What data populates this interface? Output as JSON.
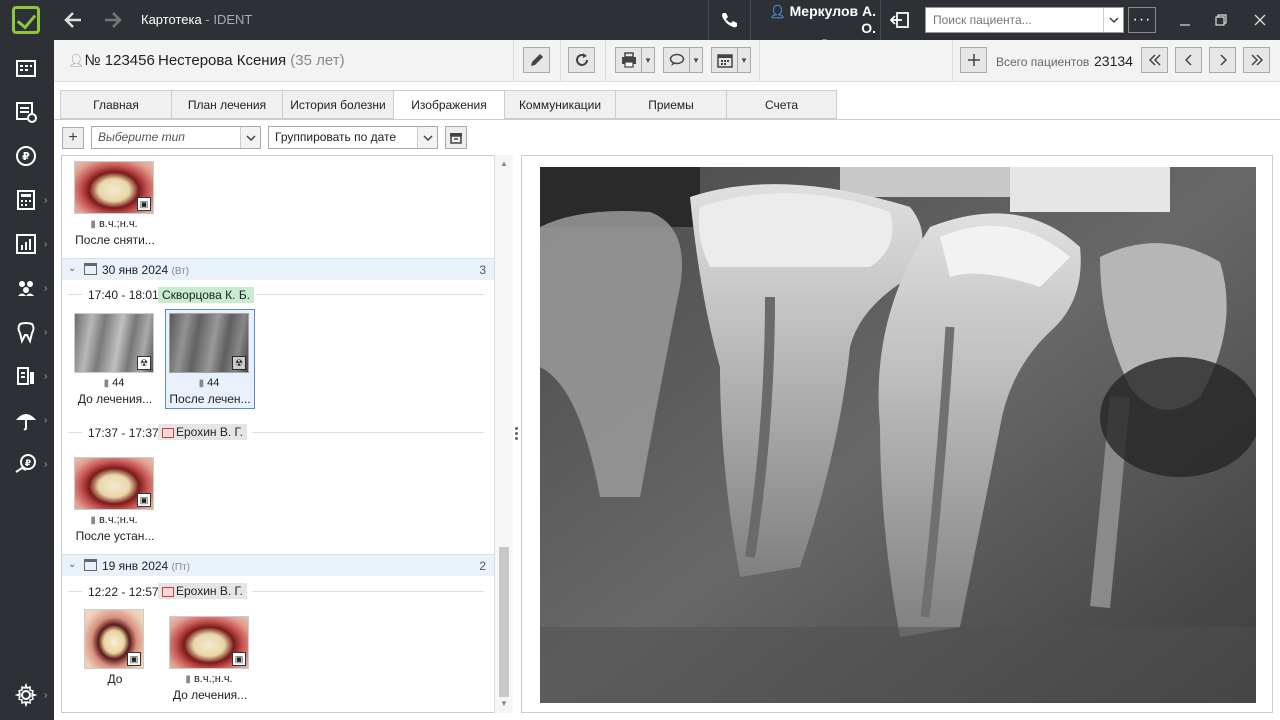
{
  "window": {
    "title": "Картотека",
    "app": "IDENT"
  },
  "user": {
    "name": "Меркулов А. О.",
    "role": "Директор"
  },
  "search": {
    "placeholder": "Поиск пациента..."
  },
  "patient": {
    "number": "№ 123456",
    "name": "Нестерова Ксения",
    "age": "(35 лет)",
    "total_label": "Всего пациентов",
    "total_value": "23134"
  },
  "tabs": [
    {
      "label": "Главная"
    },
    {
      "label": "План лечения"
    },
    {
      "label": "История болезни"
    },
    {
      "label": "Изображения",
      "active": true
    },
    {
      "label": "Коммуникации"
    },
    {
      "label": "Приемы"
    },
    {
      "label": "Счета"
    }
  ],
  "filters": {
    "type_placeholder": "Выберите тип",
    "group_value": "Группировать по дате"
  },
  "list": {
    "top_item": {
      "teeth": "в.ч.;н.ч.",
      "caption": "После сняти..."
    },
    "groups": [
      {
        "date": "30 янв 2024",
        "dow": "(Вт)",
        "count": "3",
        "visits": [
          {
            "time": "17:40 - 18:01",
            "doctor": "Скворцова К. Б.",
            "images": [
              {
                "teeth": "44",
                "caption": "До лечения..."
              },
              {
                "teeth": "44",
                "caption": "После лечен..."
              }
            ]
          },
          {
            "time": "17:37 - 17:37",
            "doctor": "Ерохин В. Г.",
            "images": [
              {
                "teeth": "в.ч.;н.ч.",
                "caption": "После устан..."
              }
            ]
          }
        ]
      },
      {
        "date": "19 янв 2024",
        "dow": "(Пт)",
        "count": "2",
        "visits": [
          {
            "time": "12:22 - 12:57",
            "doctor": "Ерохин В. Г.",
            "images": [
              {
                "teeth": "",
                "caption": "До"
              },
              {
                "teeth": "в.ч.;н.ч.",
                "caption": "До лечения..."
              }
            ]
          }
        ]
      }
    ]
  },
  "icons": {
    "back": "arrow-left-icon",
    "forward": "arrow-right-icon",
    "phone": "phone-icon",
    "user": "user-icon",
    "logout": "logout-icon",
    "edit": "pencil-icon",
    "refresh": "refresh-icon",
    "print": "printer-icon",
    "comment": "comment-icon",
    "calendar": "calendar-icon"
  },
  "colors": {
    "sidebar": "#2d3136",
    "accent_green": "#8dc63f",
    "doctor_green": "#c7ecd2",
    "group_header": "#e9f2fb",
    "user_icon": "#4a90d9"
  }
}
